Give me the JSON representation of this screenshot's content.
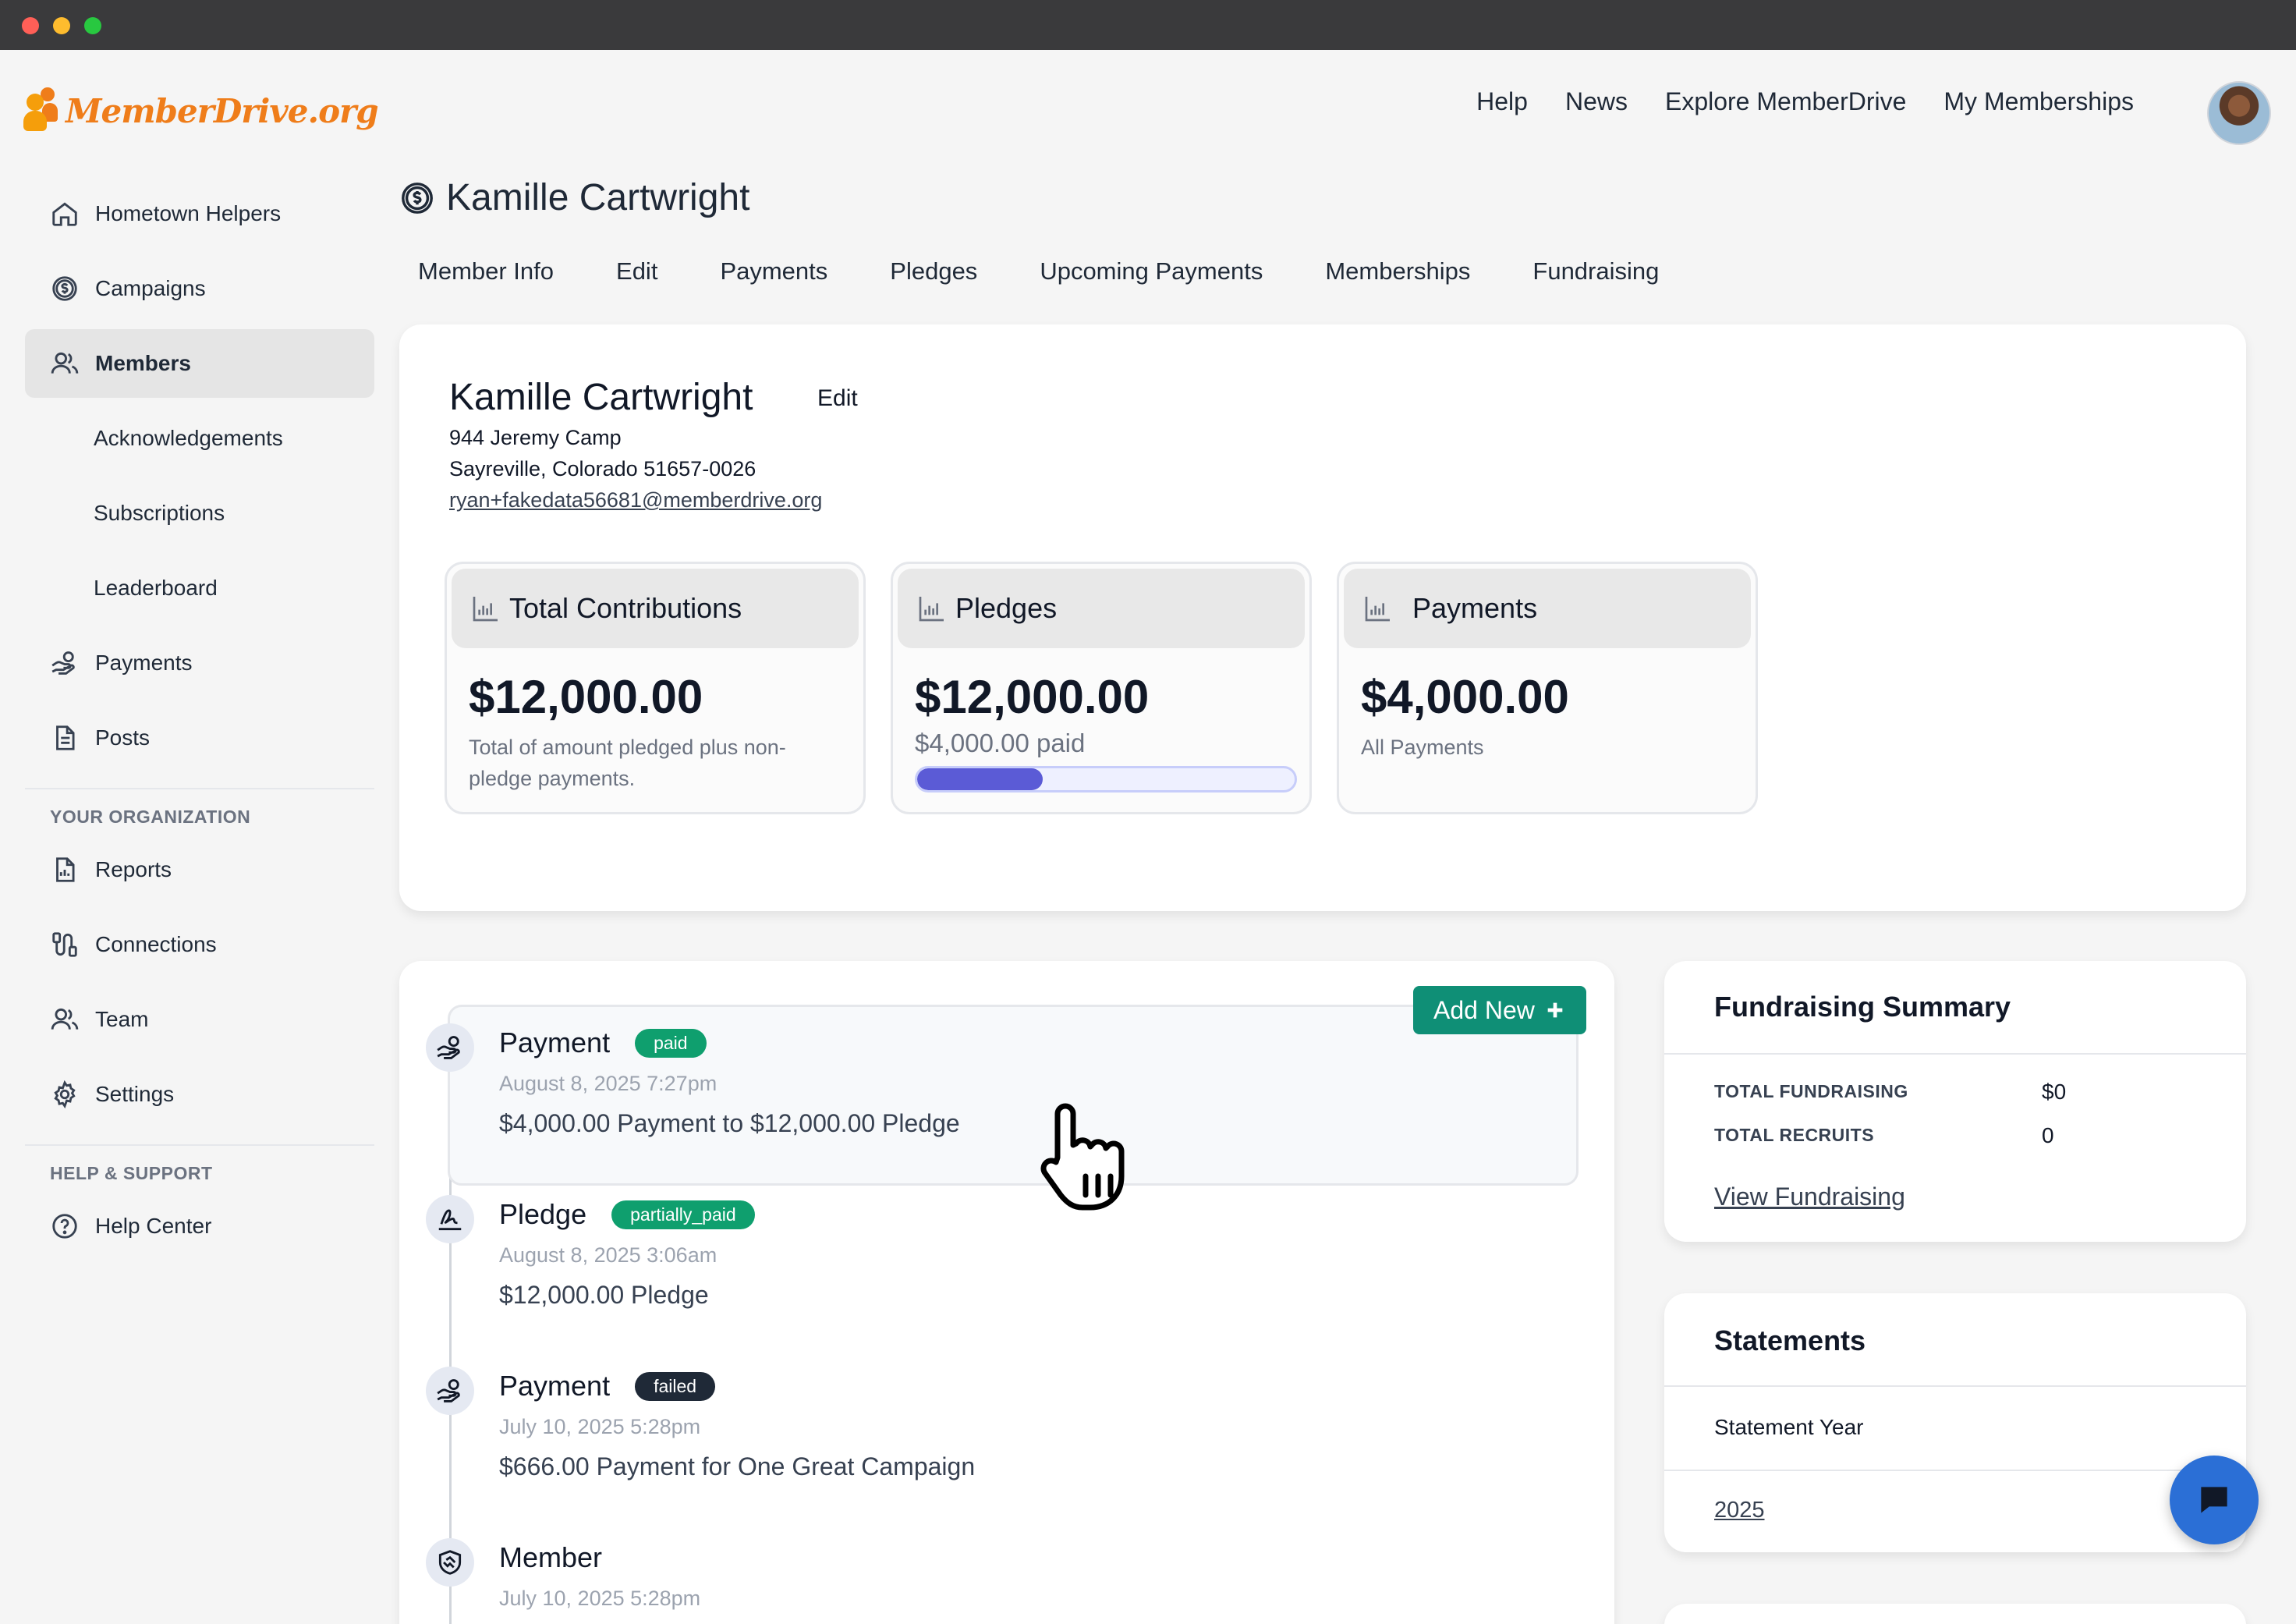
{
  "brand": {
    "name": "MemberDrive.org",
    "accent": "#ef7d1a"
  },
  "topnav": [
    "Help",
    "News",
    "Explore MemberDrive",
    "My Memberships"
  ],
  "sidebar": {
    "items": [
      {
        "label": "Hometown Helpers",
        "icon": "home-icon"
      },
      {
        "label": "Campaigns",
        "icon": "dollar-circle-icon"
      },
      {
        "label": "Members",
        "icon": "users-icon",
        "active": true
      },
      {
        "label": "Acknowledgements"
      },
      {
        "label": "Subscriptions"
      },
      {
        "label": "Leaderboard"
      },
      {
        "label": "Payments",
        "icon": "hand-coin-icon"
      },
      {
        "label": "Posts",
        "icon": "document-icon"
      }
    ],
    "org_heading": "YOUR ORGANIZATION",
    "org_items": [
      {
        "label": "Reports",
        "icon": "report-icon"
      },
      {
        "label": "Connections",
        "icon": "connections-icon"
      },
      {
        "label": "Team",
        "icon": "users-icon"
      },
      {
        "label": "Settings",
        "icon": "gear-icon"
      }
    ],
    "help_heading": "HELP & SUPPORT",
    "help_items": [
      {
        "label": "Help Center",
        "icon": "question-circle-icon"
      }
    ]
  },
  "page": {
    "title": "Kamille Cartwright",
    "tabs": [
      "Member Info",
      "Edit",
      "Payments",
      "Pledges",
      "Upcoming Payments",
      "Memberships",
      "Fundraising"
    ]
  },
  "member": {
    "name": "Kamille Cartwright",
    "edit_label": "Edit",
    "address_line1": "944 Jeremy Camp",
    "address_line2": "Sayreville, Colorado 51657-0026",
    "email": "ryan+fakedata56681@memberdrive.org"
  },
  "stats": {
    "contributions": {
      "title": "Total Contributions",
      "value": "$12,000.00",
      "sub": "Total of amount pledged plus non-pledge payments."
    },
    "pledges": {
      "title": "Pledges",
      "value": "$12,000.00",
      "paid": "$4,000.00 paid",
      "progress_fraction": 0.333
    },
    "payments": {
      "title": "Payments",
      "value": "$4,000.00",
      "sub": "All Payments"
    }
  },
  "activity": {
    "add_new_label": "Add New",
    "items": [
      {
        "type": "Payment",
        "status": "paid",
        "status_color": "#0f9f6e",
        "date": "August 8, 2025 7:27pm",
        "desc": "$4,000.00 Payment to $12,000.00 Pledge",
        "icon": "hand-coin-icon"
      },
      {
        "type": "Pledge",
        "status": "partially_paid",
        "status_color": "#0f9f6e",
        "date": "August 8, 2025 3:06am",
        "desc": "$12,000.00 Pledge",
        "icon": "signature-icon"
      },
      {
        "type": "Payment",
        "status": "failed",
        "status_color": "#1f2937",
        "date": "July 10, 2025 5:28pm",
        "desc": "$666.00 Payment for One Great Campaign",
        "icon": "hand-coin-icon"
      },
      {
        "type": "Member",
        "status": "",
        "date": "July 10, 2025 5:28pm",
        "desc": "",
        "icon": "handshake-icon"
      }
    ]
  },
  "fundraising": {
    "title": "Fundraising Summary",
    "total_fundraising_label": "TOTAL FUNDRAISING",
    "total_fundraising_value": "$0",
    "total_recruits_label": "TOTAL RECRUITS",
    "total_recruits_value": "0",
    "link_label": "View Fundraising"
  },
  "statements": {
    "title": "Statements",
    "year_label": "Statement Year",
    "years": [
      "2025"
    ]
  }
}
